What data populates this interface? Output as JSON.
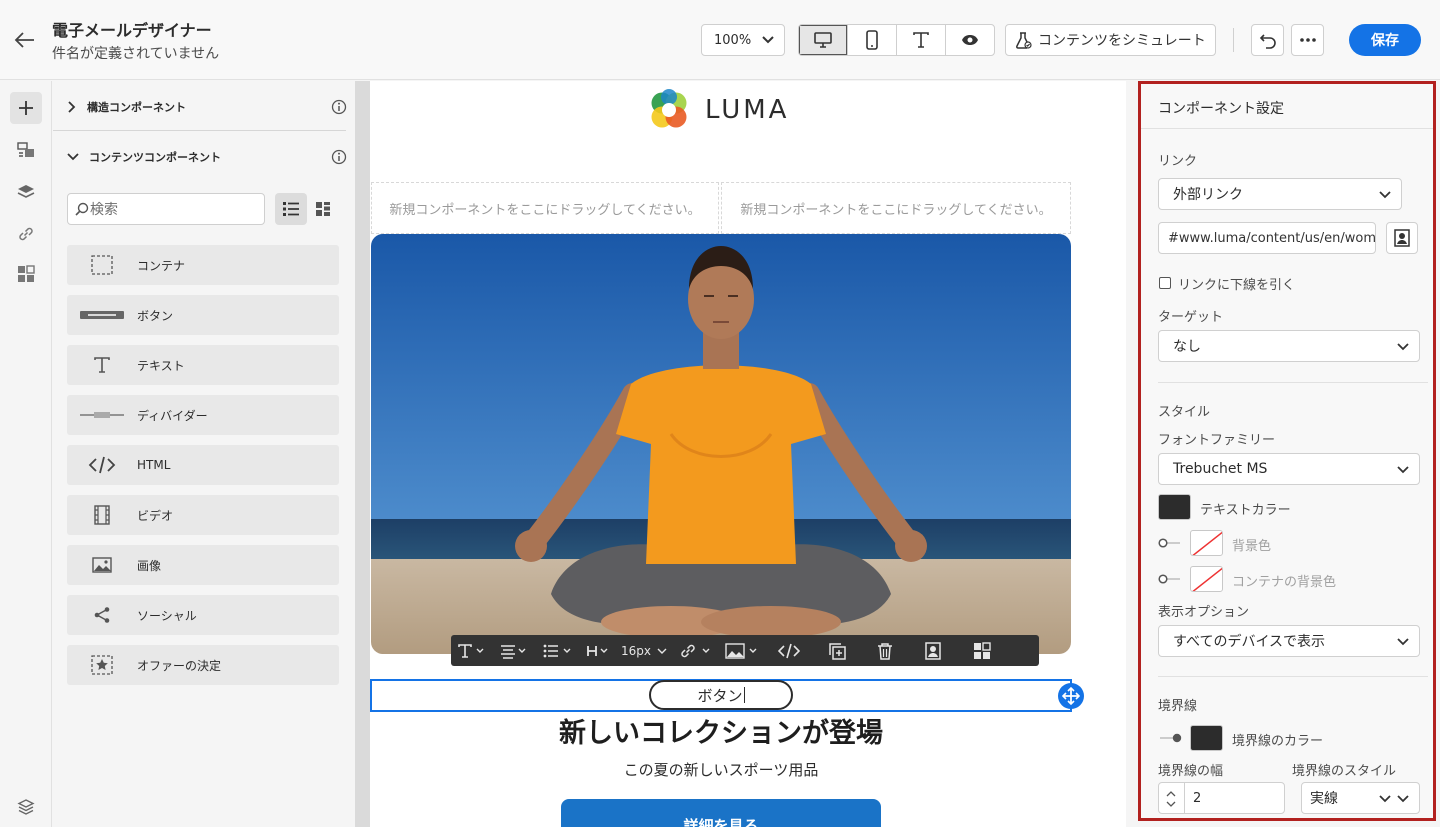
{
  "header": {
    "title": "電子メールデザイナー",
    "subtitle": "件名が定義されていません",
    "zoom": "100%",
    "simulate_label": "コンテンツをシミュレート",
    "save_label": "保存"
  },
  "components": {
    "structure_title": "構造コンポーネント",
    "content_title": "コンテンツコンポーネント",
    "search_placeholder": "検索",
    "items": [
      {
        "label": "コンテナ",
        "icon": "container-icon"
      },
      {
        "label": "ボタン",
        "icon": "button-icon"
      },
      {
        "label": "テキスト",
        "icon": "text-icon"
      },
      {
        "label": "ディバイダー",
        "icon": "divider-icon"
      },
      {
        "label": "HTML",
        "icon": "code-icon"
      },
      {
        "label": "ビデオ",
        "icon": "video-icon"
      },
      {
        "label": "画像",
        "icon": "image-icon"
      },
      {
        "label": "ソーシャル",
        "icon": "share-icon"
      },
      {
        "label": "オファーの決定",
        "icon": "offer-icon"
      }
    ]
  },
  "canvas": {
    "logo_text": "LUMA",
    "drop_text": "新規コンポーネントをここにドラッグしてください。",
    "toolbar_font_size": "16px",
    "button_text": "ボタン",
    "headline": "新しいコレクションが登場",
    "subline": "この夏の新しいスポーツ用品",
    "cta": "詳細を見る"
  },
  "settings": {
    "title": "コンポーネント設定",
    "link_label": "リンク",
    "link_type": "外部リンク",
    "url": "#www.luma/content/us/en/women.html",
    "underline_label": "リンクに下線を引く",
    "target_label": "ターゲット",
    "target_value": "なし",
    "style_label": "スタイル",
    "font_family_label": "フォントファミリー",
    "font_family_value": "Trebuchet MS",
    "text_color_label": "テキストカラー",
    "bg_color_label": "背景色",
    "container_bg_label": "コンテナの背景色",
    "display_label": "表示オプション",
    "display_value": "すべてのデバイスで表示",
    "border_label": "境界線",
    "border_color_label": "境界線のカラー",
    "border_width_label": "境界線の幅",
    "border_width_value": "2",
    "border_style_label": "境界線のスタイル",
    "border_style_value": "実線"
  },
  "colors": {
    "accent": "#1473e6",
    "highlight_border": "#b2211f",
    "text_color": "#2c2c2c",
    "cta": "#1a73c7"
  }
}
